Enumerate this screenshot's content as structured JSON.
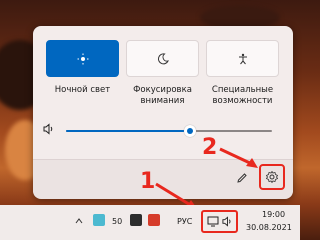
{
  "quick_settings": {
    "tiles": [
      {
        "label": "Ночной свет",
        "icon": "brightness-icon",
        "active": true
      },
      {
        "label": "Фокусировка внимания",
        "icon": "moon-icon",
        "active": false
      },
      {
        "label": "Специальные возможности",
        "icon": "accessibility-icon",
        "active": false
      }
    ],
    "volume": {
      "icon": "speaker-icon",
      "level": 0.6
    },
    "footer": {
      "edit_icon": "pencil-icon",
      "settings_icon": "gear-icon"
    }
  },
  "taskbar": {
    "notification_count": "50",
    "language": "РУС",
    "time": "19:00",
    "date": "30.08.2021",
    "tray_icons": [
      "app-icon",
      "network-icon",
      "speaker-icon",
      "chevron-up-icon"
    ]
  },
  "annotations": {
    "one": "1",
    "two": "2",
    "color": "#e8281e"
  },
  "colors": {
    "accent": "#0067c0"
  }
}
